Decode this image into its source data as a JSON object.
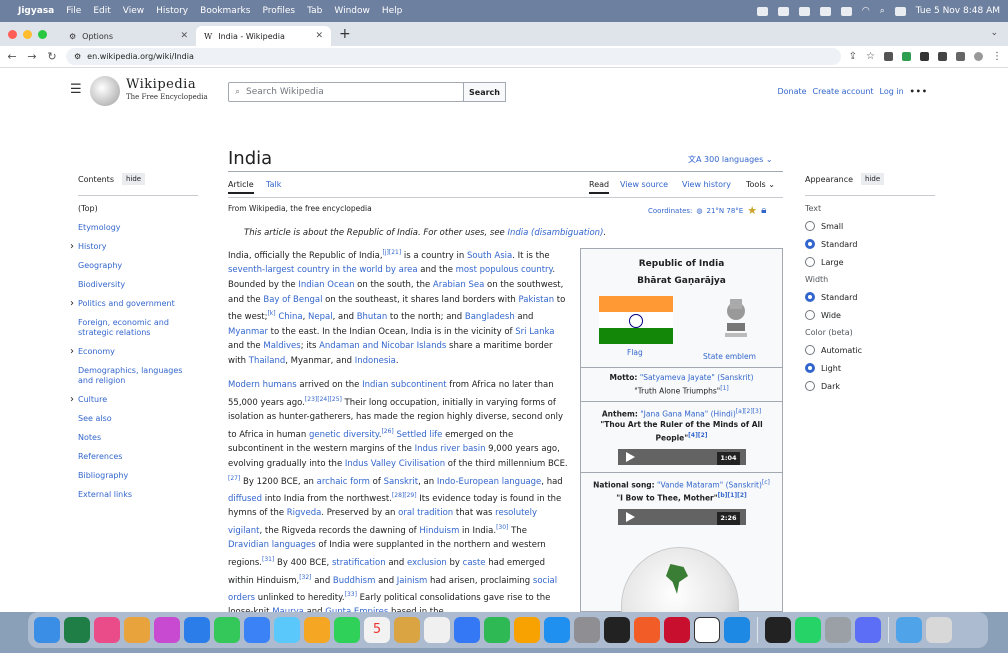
{
  "menubar": {
    "app": "Jigyasa",
    "items": [
      "File",
      "Edit",
      "View",
      "History",
      "Bookmarks",
      "Profiles",
      "Tab",
      "Window",
      "Help"
    ],
    "clock": "Tue 5 Nov  8:48 AM"
  },
  "browser": {
    "tabs": [
      {
        "title": "Options",
        "active": false
      },
      {
        "title": "India - Wikipedia",
        "active": true
      }
    ],
    "url": "en.wikipedia.org/wiki/India"
  },
  "wiki": {
    "wordmark": "Wikipedia",
    "tagline": "The Free Encyclopedia",
    "search_placeholder": "Search Wikipedia",
    "search_button": "Search",
    "top_links": [
      "Donate",
      "Create account",
      "Log in"
    ],
    "more": "•••",
    "title": "India",
    "languages": "300 languages",
    "toc": {
      "heading": "Contents",
      "hide": "hide",
      "items": [
        {
          "label": "(Top)",
          "expand": false
        },
        {
          "label": "Etymology",
          "expand": false
        },
        {
          "label": "History",
          "expand": true
        },
        {
          "label": "Geography",
          "expand": false
        },
        {
          "label": "Biodiversity",
          "expand": false
        },
        {
          "label": "Politics and government",
          "expand": true
        },
        {
          "label": "Foreign, economic and strategic relations",
          "expand": false
        },
        {
          "label": "Economy",
          "expand": true
        },
        {
          "label": "Demographics, languages and religion",
          "expand": false
        },
        {
          "label": "Culture",
          "expand": true
        },
        {
          "label": "See also",
          "expand": false
        },
        {
          "label": "Notes",
          "expand": false
        },
        {
          "label": "References",
          "expand": false
        },
        {
          "label": "Bibliography",
          "expand": false
        },
        {
          "label": "External links",
          "expand": false
        }
      ]
    },
    "tabs": {
      "article": "Article",
      "talk": "Talk",
      "read": "Read",
      "view_source": "View source",
      "view_history": "View history",
      "tools": "Tools"
    },
    "from": "From Wikipedia, the free encyclopedia",
    "coordinates": "Coordinates:",
    "coord_value": "21°N 78°E",
    "hatnote_pre": "This article is about the Republic of India. For other uses, see ",
    "hatnote_link": "India (disambiguation)",
    "infobox": {
      "name1": "Republic of India",
      "name2": "Bhārat Gaṇarājya",
      "flag_caption": "Flag",
      "emblem_caption": "State emblem",
      "motto_label": "Motto:",
      "motto": "\"Satyameva Jayate\"",
      "motto_lang": "(Sanskrit)",
      "motto_trans": "\"Truth Alone Triumphs\"",
      "anthem_label": "Anthem:",
      "anthem": "\"Jana Gana Mana\"",
      "anthem_lang": "(Hindi)",
      "anthem_trans": "\"Thou Art the Ruler of the Minds of All People\"",
      "anthem_duration": "1:04",
      "song_label": "National song:",
      "song": "\"Vande Mataram\"",
      "song_lang": "(Sanskrit)",
      "song_trans": "\"I Bow to Thee, Mother\"",
      "song_duration": "2:26"
    },
    "appearance": {
      "heading": "Appearance",
      "hide": "hide",
      "text_label": "Text",
      "text_options": [
        {
          "label": "Small",
          "selected": false
        },
        {
          "label": "Standard",
          "selected": true
        },
        {
          "label": "Large",
          "selected": false
        }
      ],
      "width_label": "Width",
      "width_options": [
        {
          "label": "Standard",
          "selected": true
        },
        {
          "label": "Wide",
          "selected": false
        }
      ],
      "color_label": "Color (beta)",
      "color_options": [
        {
          "label": "Automatic",
          "selected": false
        },
        {
          "label": "Light",
          "selected": true
        },
        {
          "label": "Dark",
          "selected": false
        }
      ]
    }
  },
  "colors": {
    "link": "#3366cc",
    "saffron": "#ff9933",
    "green": "#138808"
  }
}
